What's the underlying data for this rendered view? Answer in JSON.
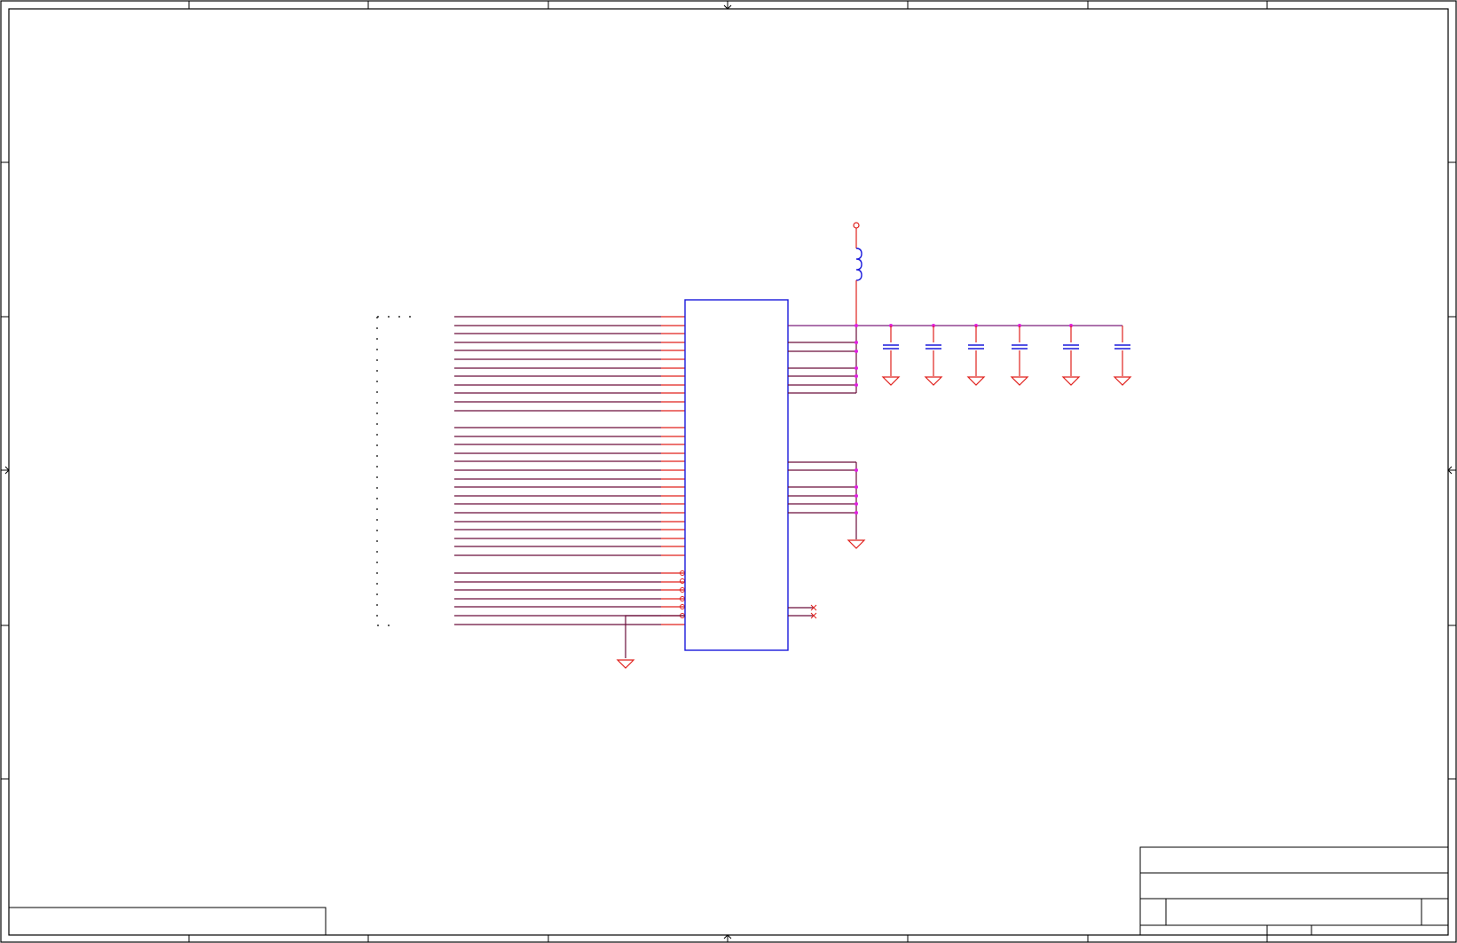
{
  "sheet": {
    "border_color": "#000000",
    "net_color": "#e0201c",
    "bus_color": "#6a0d3a",
    "component_color": "#1a1adc",
    "junction_color": "#e020e0",
    "background": "#ffffff"
  },
  "schematic": {
    "components": [
      "ic",
      "inductor",
      "capacitor",
      "capacitor",
      "capacitor",
      "capacitor",
      "capacitor",
      "capacitor",
      "connector"
    ],
    "power_port_icon": "circle-port-icon",
    "ground_icon": "ground-triangle-icon",
    "no_connect_icon": "x-mark-icon"
  },
  "title_block": {
    "title": "",
    "number": "",
    "revision": ""
  }
}
